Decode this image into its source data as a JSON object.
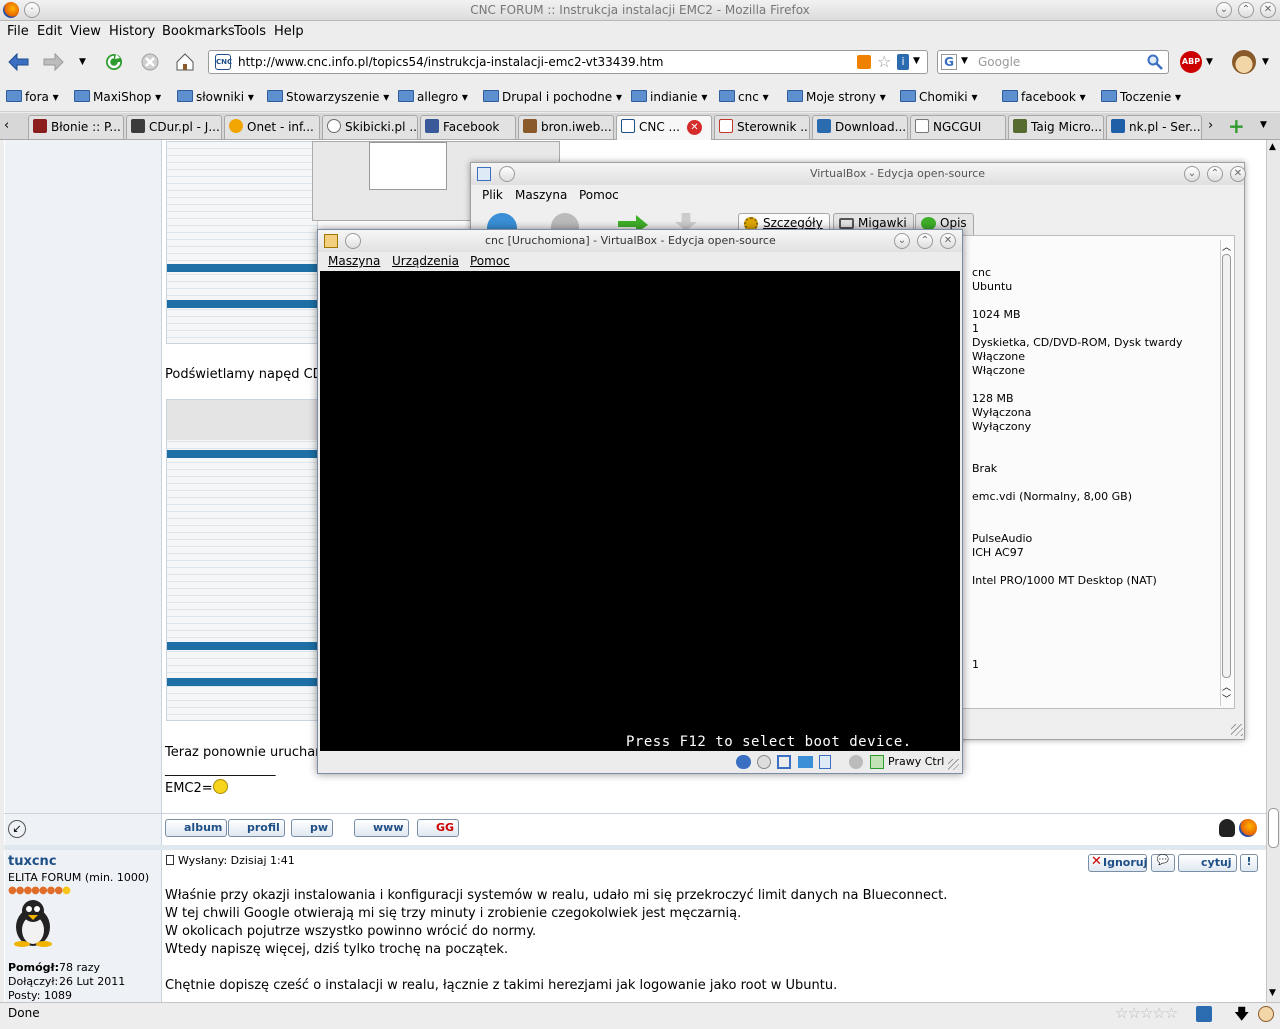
{
  "window": {
    "title": "CNC FORUM :: Instrukcja instalacji EMC2 - Mozilla Firefox"
  },
  "menu": [
    "File",
    "Edit",
    "View",
    "History",
    "Bookmarks",
    "Tools",
    "Help"
  ],
  "nav": {
    "url": "http://www.cnc.info.pl/topics54/instrukcja-instalacji-emc2-vt33439.htm",
    "search_placeholder": "Google",
    "abp_label": "ABP"
  },
  "bookmarks": [
    "fora",
    "MaxiShop",
    "słowniki",
    "Stowarzyszenie",
    "allegro",
    "Drupal i pochodne",
    "indianie",
    "cnc",
    "Moje strony",
    "Chomiki",
    "facebook",
    "Toczenie"
  ],
  "tabs": [
    {
      "label": "Błonie :: P...",
      "color": "#8b1d1d"
    },
    {
      "label": "CDur.pl - J...",
      "color": "#3b3b3b"
    },
    {
      "label": "Onet - inf...",
      "color": "#f0a500"
    },
    {
      "label": "Skibicki.pl ...",
      "color": "#6b6b6b"
    },
    {
      "label": "Facebook",
      "color": "#3b5998"
    },
    {
      "label": "bron.iweb....",
      "color": "#8a5a2b"
    },
    {
      "label": "CNC ...",
      "color": "#1e4f86"
    },
    {
      "label": "Sterownik ...",
      "color": "#c0392b"
    },
    {
      "label": "Download...",
      "color": "#2b6cb0"
    },
    {
      "label": "NGCGUI",
      "color": "#777777"
    },
    {
      "label": "Taig Micro...",
      "color": "#556b2f"
    },
    {
      "label": "nk.pl - Ser...",
      "color": "#1f5fa8"
    }
  ],
  "post1": {
    "text_cd": "Podświetlamy napęd CD p",
    "text_restart": "Teraz ponownie uruchami",
    "signature_line": "_________________",
    "signature": "EMC2=",
    "buttons": [
      "album",
      "profil",
      "pw",
      "www",
      "GG"
    ]
  },
  "post2": {
    "author": "tuxcnc",
    "rank": "ELITA FORUM (min. 1000)",
    "helped_label": "Pomógł:",
    "helped_value": "78 razy",
    "joined_label": "Dołączył:",
    "joined_value": "26 Lut 2011",
    "posts_label": "Posty:",
    "posts_value": "1089",
    "date": "Wysłany:  Dzisiaj 1:41",
    "actions": [
      "Ignoruj",
      "cytuj"
    ],
    "lines": [
      "Właśnie przy okazji instalowania i konfiguracji systemów w realu, udało mi się przekroczyć limit danych na Blueconnect.",
      "W tej chwili Google otwierają mi się trzy minuty i zrobienie czegokolwiek jest męczarnią.",
      "W okolicach pojutrze wszystko powinno wrócić do normy.",
      "Wtedy napiszę więcej, dziś tylko trochę na początek.",
      "",
      "Chętnie dopiszę cześć o instalacji w realu, łącznie z takimi herezjami jak logowanie jako root w Ubuntu."
    ]
  },
  "status": {
    "text": "Done"
  },
  "vbox_manager": {
    "title": "VirtualBox - Edycja open-source",
    "menu": [
      "Plik",
      "Maszyna",
      "Pomoc"
    ],
    "tabs": [
      "Szczegóły",
      "Migawki",
      "Opis"
    ],
    "details": [
      {
        "text": "cnc",
        "row": 0
      },
      {
        "text": "Ubuntu",
        "row": 1
      },
      {
        "text": "1024 MB",
        "row": 3
      },
      {
        "text": "1",
        "row": 4
      },
      {
        "text": "Dyskietka, CD/DVD-ROM, Dysk twardy",
        "row": 5
      },
      {
        "text": "Włączone",
        "row": 6
      },
      {
        "text": "Włączone",
        "row": 7
      },
      {
        "text": "128 MB",
        "row": 9
      },
      {
        "text": "Wyłączona",
        "row": 10
      },
      {
        "text": "Wyłączony",
        "row": 11
      },
      {
        "text": "Brak",
        "row": 14
      },
      {
        "text": "emc.vdi (Normalny, 8,00 GB)",
        "row": 16
      },
      {
        "text": "PulseAudio",
        "row": 19
      },
      {
        "text": "ICH AC97",
        "row": 20
      },
      {
        "text": "Intel PRO/1000 MT Desktop (NAT)",
        "row": 22
      },
      {
        "text": "1",
        "row": 28
      }
    ]
  },
  "vm_window": {
    "title": "cnc [Uruchomiona] - VirtualBox - Edycja open-source",
    "menu": [
      "Maszyna",
      "Urządzenia",
      "Pomoc"
    ],
    "boot_message": "Press F12 to select boot device.",
    "host_key": "Prawy Ctrl"
  }
}
